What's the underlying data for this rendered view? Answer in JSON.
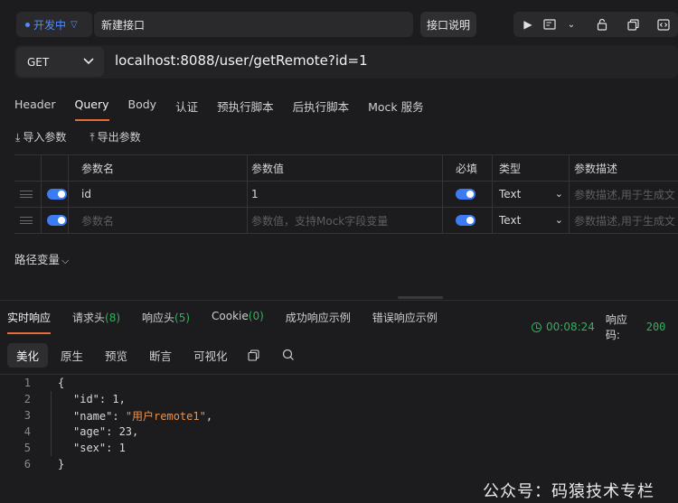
{
  "top": {
    "env_label": "开发中",
    "api_name": "新建接口",
    "doc_button": "接口说明",
    "tool_icons": [
      "play-icon",
      "save-icon",
      "chevron-down-icon",
      "lock-icon",
      "copy-icon",
      "code-icon"
    ]
  },
  "request": {
    "method": "GET",
    "url": "localhost:8088/user/getRemote?id=1",
    "tabs": [
      "Header",
      "Query",
      "Body",
      "认证",
      "预执行脚本",
      "后执行脚本",
      "Mock 服务"
    ],
    "active_tab": "Query",
    "import_label": "导入参数",
    "export_label": "导出参数"
  },
  "params": {
    "headers": [
      "参数名",
      "参数值",
      "必填",
      "类型",
      "参数描述"
    ],
    "rows": [
      {
        "name": "id",
        "value": "1",
        "required": true,
        "type": "Text",
        "desc_placeholder": "参数描述,用于生成文"
      },
      {
        "name_placeholder": "参数名",
        "value_placeholder": "参数值，支持Mock字段变量",
        "required": true,
        "type": "Text",
        "desc_placeholder": "参数描述,用于生成文"
      }
    ],
    "path_var_label": "路径变量"
  },
  "response": {
    "tabs": [
      {
        "label": "实时响应",
        "count": ""
      },
      {
        "label": "请求头",
        "count": "(8)"
      },
      {
        "label": "响应头",
        "count": "(5)"
      },
      {
        "label": "Cookie",
        "count": "(0)"
      },
      {
        "label": "成功响应示例",
        "count": ""
      },
      {
        "label": "错误响应示例",
        "count": ""
      }
    ],
    "time": "00:08:24",
    "status_label": "响应码:",
    "status_code": "200",
    "format_tabs": [
      "美化",
      "原生",
      "预览",
      "断言",
      "可视化"
    ],
    "active_format": "美化",
    "accent_color": "#2fb35c"
  },
  "code_lines": [
    {
      "n": "1",
      "text": "{"
    },
    {
      "n": "2",
      "key": "\"id\"",
      "val": "1",
      "valType": "num",
      "tail": ","
    },
    {
      "n": "3",
      "key": "\"name\"",
      "val": "\"用户remote1\"",
      "valType": "str",
      "tail": ","
    },
    {
      "n": "4",
      "key": "\"age\"",
      "val": "23",
      "valType": "num",
      "tail": ","
    },
    {
      "n": "5",
      "key": "\"sex\"",
      "val": "1",
      "valType": "num",
      "tail": ""
    },
    {
      "n": "6",
      "text": "}"
    }
  ],
  "watermark": "公众号：码猿技术专栏"
}
